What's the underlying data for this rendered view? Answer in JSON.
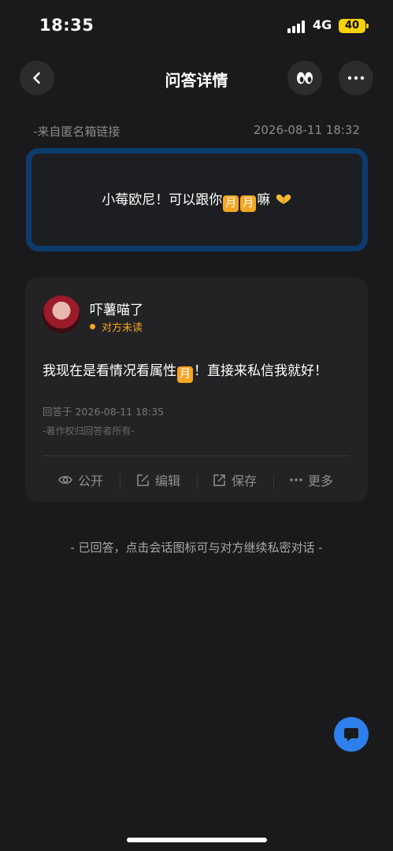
{
  "status_bar": {
    "time": "18:35",
    "network": "4G",
    "battery": "40"
  },
  "header": {
    "title": "问答详情",
    "back_icon": "chevron-left-icon",
    "eyes_icon": "eyes-emoji-icon",
    "more_icon": "more-horizontal-icon"
  },
  "question": {
    "source": "-来自匿名箱链接",
    "date": "2026-08-11 18:32",
    "text_before": "小莓欧尼！可以跟你",
    "moon_char": "月",
    "text_after": "嘛",
    "emoji": "heart-hands-icon"
  },
  "answer": {
    "username": "吓薯喵了",
    "read_status": "对方未读",
    "text_before": "我现在是看情况看属性",
    "moon_char": "月",
    "text_after": "！直接来私信我就好！",
    "answered_at": "回答于 2026-08-11 18:35",
    "copyright": "-著作权归回答者所有-",
    "actions": {
      "public": "公开",
      "edit": "编辑",
      "save": "保存",
      "more": "更多"
    }
  },
  "footer_note": "- 已回答，点击会话图标可与对方继续私密对话 -",
  "colors": {
    "background": "#1a1a1c",
    "card": "#232325",
    "question_border": "#0c3c6e",
    "accent_orange": "#f5a623",
    "fab_blue": "#2f80ed"
  }
}
